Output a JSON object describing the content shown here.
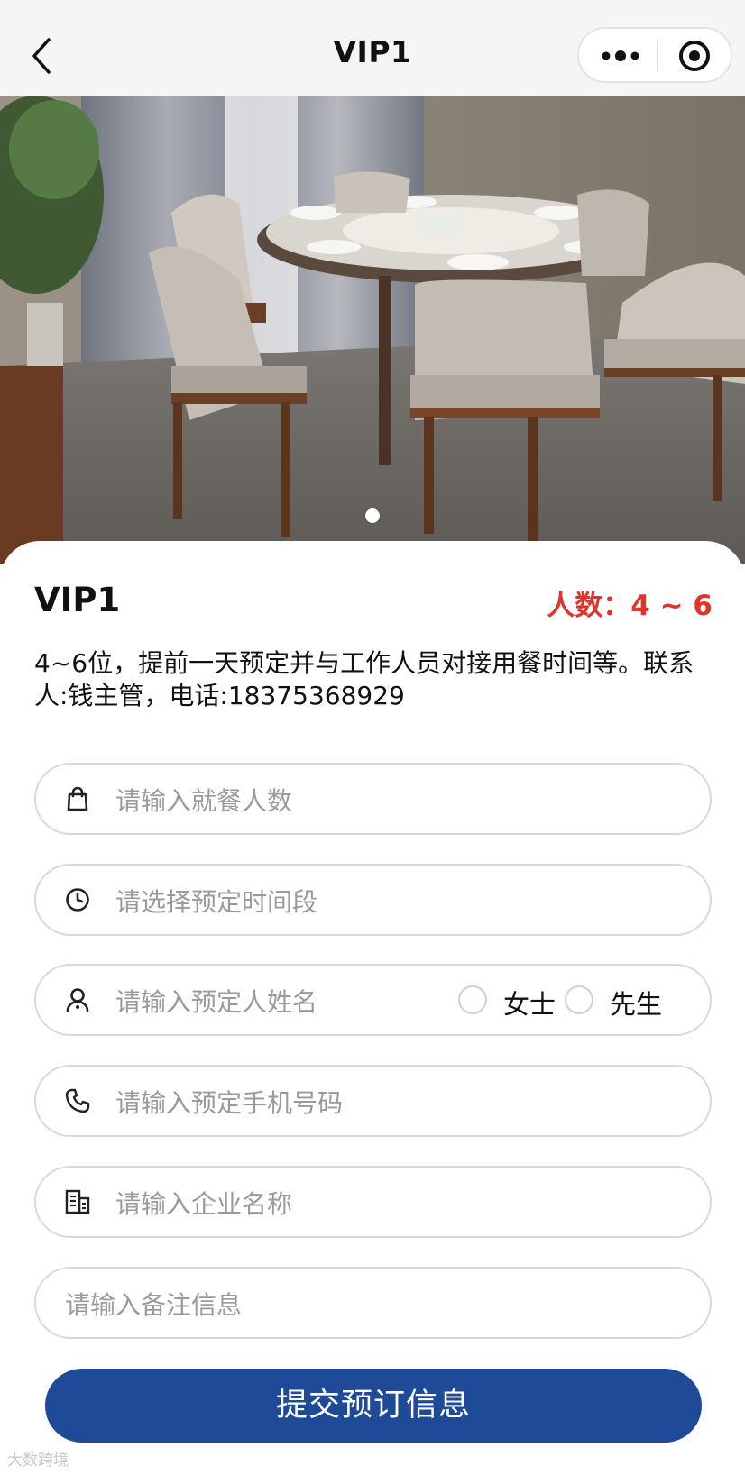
{
  "navbar": {
    "title": "VIP1",
    "back_icon": "chevron-left-icon",
    "more_icon": "more-dots-icon",
    "close_icon": "target-circle-icon"
  },
  "banner": {
    "image_alt": "Private dining room with round table and chairs",
    "slide_count": 1,
    "active_slide": 1
  },
  "room": {
    "name": "VIP1",
    "capacity": "人数：4 ~ 6",
    "description": "4~6位，提前一天预定并与工作人员对接用餐时间等。联系人:钱主管，电话:18375368929"
  },
  "form": {
    "guests": {
      "placeholder": "请输入就餐人数",
      "value": "",
      "icon": "bag-icon"
    },
    "time_slot": {
      "placeholder": "请选择预定时间段",
      "value": "",
      "icon": "clock-icon"
    },
    "name": {
      "placeholder": "请输入预定人姓名",
      "value": "",
      "icon": "person-icon",
      "gender_options": [
        "女士",
        "先生"
      ],
      "gender_selected": null
    },
    "phone": {
      "placeholder": "请输入预定手机号码",
      "value": "",
      "icon": "phone-icon"
    },
    "company": {
      "placeholder": "请输入企业名称",
      "value": "",
      "icon": "building-icon"
    },
    "remark": {
      "placeholder": "请输入备注信息",
      "value": ""
    }
  },
  "submit_label": "提交预订信息",
  "watermark": "大数跨境",
  "colors": {
    "accent_red": "#e0332b",
    "button_blue": "#1f4a97",
    "border_gray": "#d9d9d9",
    "placeholder_gray": "#9a9a9a"
  }
}
